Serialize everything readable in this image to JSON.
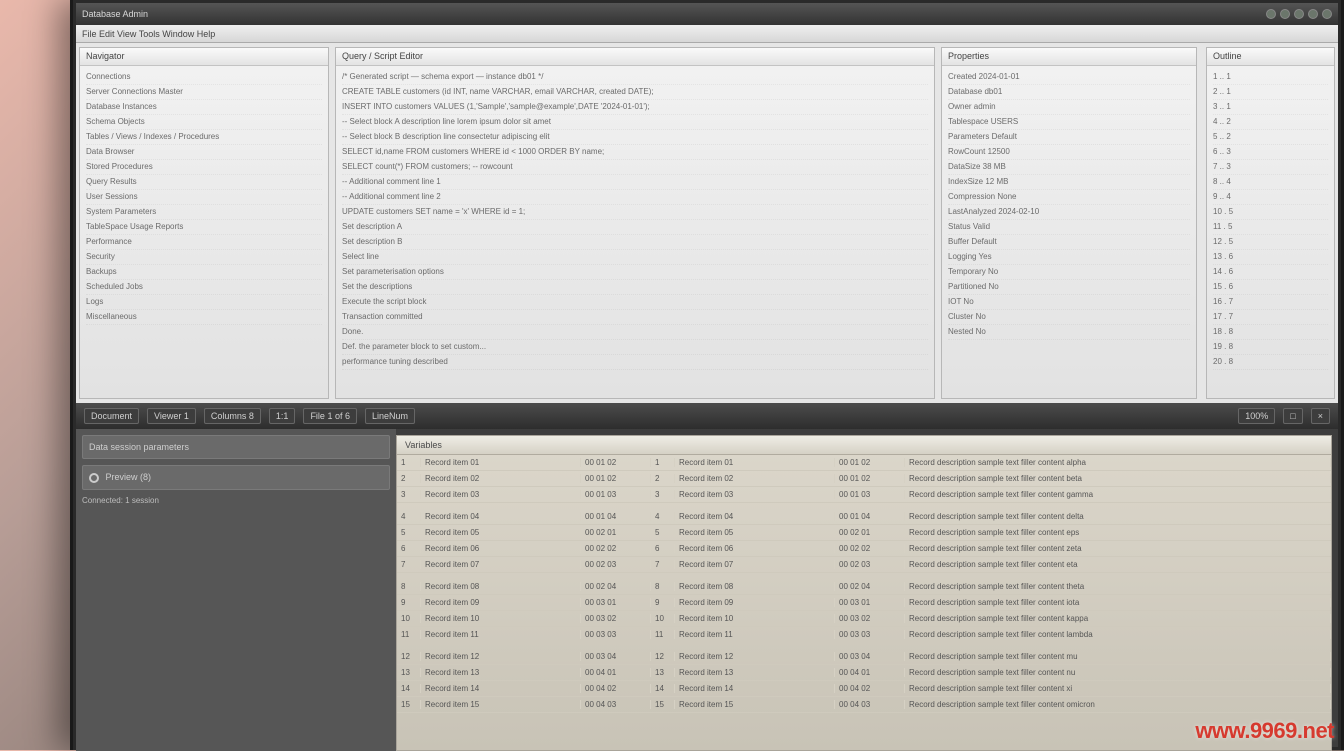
{
  "titlebar": {
    "app_label": "Database Admin"
  },
  "menubar": {
    "label": "File  Edit  View  Tools  Window  Help"
  },
  "left_pane": {
    "title": "Navigator",
    "lines": [
      "Connections",
      "Server Connections Master",
      "Database Instances",
      "Schema Objects",
      "Tables / Views / Indexes / Procedures",
      "Data Browser",
      "Stored Procedures",
      "Query Results",
      "User Sessions",
      "System Parameters",
      "TableSpace Usage Reports",
      "Performance",
      "Security",
      "Backups",
      "Scheduled Jobs",
      "Logs",
      "Miscellaneous"
    ]
  },
  "mid_pane": {
    "title": "Query / Script Editor",
    "lines": [
      "/* Generated script — schema export — instance db01 */",
      "CREATE TABLE customers (id INT, name VARCHAR, email VARCHAR, created DATE);",
      "INSERT INTO customers VALUES (1,'Sample','sample@example',DATE '2024-01-01');",
      "-- Select block A description line lorem ipsum dolor sit amet",
      "-- Select block B description line consectetur adipiscing elit",
      "SELECT id,name FROM customers WHERE id < 1000 ORDER BY name;",
      "SELECT count(*)        FROM customers;            -- rowcount",
      "-- Additional comment line 1",
      "-- Additional comment line 2",
      "UPDATE customers SET name = 'x' WHERE id = 1;",
      "Set description A",
      "Set description B",
      "Select line",
      "Set parameterisation options",
      "Set the descriptions",
      "Execute the script block",
      "Transaction committed",
      "Done.",
      "Def. the parameter block to set custom...",
      "performance tuning described"
    ]
  },
  "right_pane": {
    "title": "Properties",
    "rows": [
      {
        "k": "Created",
        "v": "2024-01-01"
      },
      {
        "k": "Database",
        "v": "db01"
      },
      {
        "k": "Owner",
        "v": "admin"
      },
      {
        "k": "Tablespace",
        "v": "USERS"
      },
      {
        "k": "Parameters",
        "v": "Default"
      },
      {
        "k": "RowCount",
        "v": "12500"
      },
      {
        "k": "DataSize",
        "v": "38 MB"
      },
      {
        "k": "IndexSize",
        "v": "12 MB"
      },
      {
        "k": "Compression",
        "v": "None"
      },
      {
        "k": "LastAnalyzed",
        "v": "2024-02-10"
      },
      {
        "k": "Status",
        "v": "Valid"
      },
      {
        "k": "Buffer",
        "v": "Default"
      },
      {
        "k": "Logging",
        "v": "Yes"
      },
      {
        "k": "Temporary",
        "v": "No"
      },
      {
        "k": "Partitioned",
        "v": "No"
      },
      {
        "k": "IOT",
        "v": "No"
      },
      {
        "k": "Cluster",
        "v": "No"
      },
      {
        "k": "Nested",
        "v": "No"
      }
    ]
  },
  "mini_pane": {
    "title": "Outline",
    "lines": [
      "1 .. 1",
      "2 .. 1",
      "3 .. 1",
      "4 .. 2",
      "5 .. 2",
      "6 .. 3",
      "7 .. 3",
      "8 .. 4",
      "9 .. 4",
      "10 . 5",
      "11 . 5",
      "12 . 5",
      "13 . 6",
      "14 . 6",
      "15 . 6",
      "16 . 7",
      "17 . 7",
      "18 . 8",
      "19 . 8",
      "20 . 8"
    ]
  },
  "toolbar": {
    "items": [
      "Document",
      "Viewer 1",
      "Columns 8",
      "1:1",
      "File 1 of 6",
      "LineNum"
    ],
    "right": [
      "100%",
      "□",
      "×"
    ]
  },
  "lower_left": {
    "header": "Data session parameters",
    "radio_label": "Preview (8)",
    "status": "Connected: 1 session"
  },
  "grid": {
    "title": "Variables",
    "rows": [
      {
        "i": "1",
        "n": "Record item 01",
        "v": "00 01 02",
        "d": "Record description sample text filler content alpha"
      },
      {
        "i": "2",
        "n": "Record item 02",
        "v": "00 01 02",
        "d": "Record description sample text filler content beta"
      },
      {
        "i": "3",
        "n": "Record item 03",
        "v": "00 01 03",
        "d": "Record description sample text filler content gamma"
      },
      {
        "i": "4",
        "n": "Record item 04",
        "v": "00 01 04",
        "d": "Record description sample text filler content delta"
      },
      {
        "i": "5",
        "n": "Record item 05",
        "v": "00 02 01",
        "d": "Record description sample text filler content eps"
      },
      {
        "i": "6",
        "n": "Record item 06",
        "v": "00 02 02",
        "d": "Record description sample text filler content zeta"
      },
      {
        "i": "7",
        "n": "Record item 07",
        "v": "00 02 03",
        "d": "Record description sample text filler content eta"
      },
      {
        "i": "8",
        "n": "Record item 08",
        "v": "00 02 04",
        "d": "Record description sample text filler content theta"
      },
      {
        "i": "9",
        "n": "Record item 09",
        "v": "00 03 01",
        "d": "Record description sample text filler content iota"
      },
      {
        "i": "10",
        "n": "Record item 10",
        "v": "00 03 02",
        "d": "Record description sample text filler content kappa"
      },
      {
        "i": "11",
        "n": "Record item 11",
        "v": "00 03 03",
        "d": "Record description sample text filler content lambda"
      },
      {
        "i": "12",
        "n": "Record item 12",
        "v": "00 03 04",
        "d": "Record description sample text filler content mu"
      },
      {
        "i": "13",
        "n": "Record item 13",
        "v": "00 04 01",
        "d": "Record description sample text filler content nu"
      },
      {
        "i": "14",
        "n": "Record item 14",
        "v": "00 04 02",
        "d": "Record description sample text filler content xi"
      },
      {
        "i": "15",
        "n": "Record item 15",
        "v": "00 04 03",
        "d": "Record description sample text filler content omicron"
      }
    ]
  },
  "watermark": "www.9969.net"
}
